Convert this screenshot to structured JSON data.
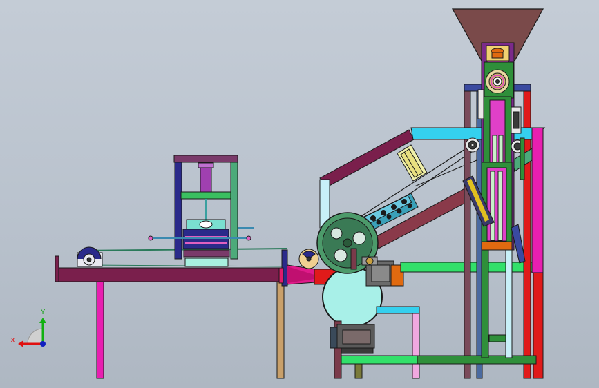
{
  "view_triad": {
    "x_label": "X",
    "y_label": "Y",
    "x_color": "#e01010",
    "y_color": "#10b010",
    "z_color": "#1020c0"
  },
  "colors": {
    "background": "#bcc5cf",
    "outline": "#1a1a1a",
    "frame_maroon": "#7a1f4c",
    "leg_magenta": "#e81fb0",
    "leg_tan": "#c9a06a",
    "hopper": "#7a4a4a",
    "column_green": "#2f8f3a",
    "column_purple": "#7b2a8a",
    "rail_red": "#e01a1a",
    "beam_cyan": "#35d0ee",
    "beam_green": "#32e06a",
    "blower": "#a8f0e8",
    "pink_leg": "#f0a8e0",
    "wheel_green": "#4c9a6a",
    "motor_orange": "#e06a10",
    "dark_beam": "#7a3a3a",
    "press_blue": "#2a2a8a",
    "roller_teal": "#3aa0b8"
  }
}
